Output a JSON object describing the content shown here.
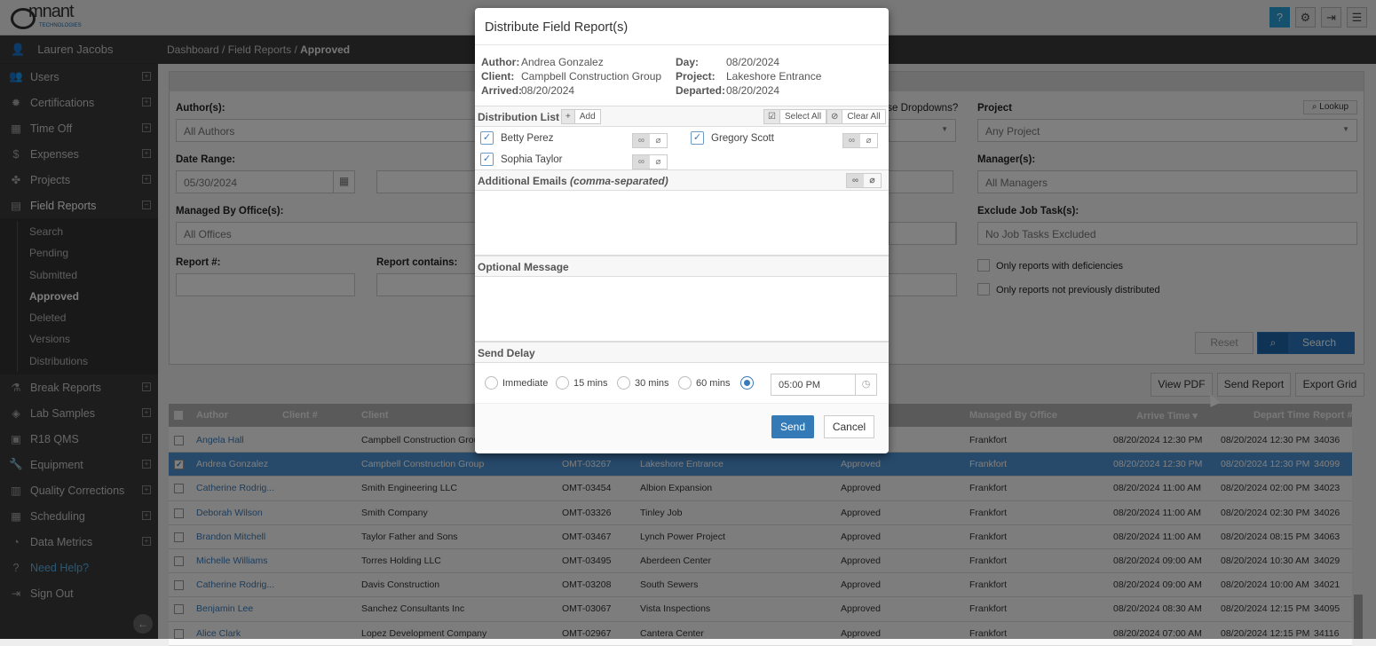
{
  "brand": {
    "name": "mnant",
    "tagline": "TECHNOLOGIES"
  },
  "topbar": {
    "icons": [
      "help-icon",
      "gear-icon",
      "logout-icon",
      "menu-icon"
    ]
  },
  "sidebar": {
    "user": "Lauren Jacobs",
    "items": [
      {
        "label": "Users",
        "icon": "users-icon",
        "glyph": "👥"
      },
      {
        "label": "Certifications",
        "icon": "certificate-icon",
        "glyph": "✹"
      },
      {
        "label": "Time Off",
        "icon": "calendar-clock-icon",
        "glyph": "▦"
      },
      {
        "label": "Expenses",
        "icon": "dollar-icon",
        "glyph": "$"
      },
      {
        "label": "Projects",
        "icon": "puzzle-icon",
        "glyph": "✤"
      },
      {
        "label": "Field Reports",
        "icon": "document-icon",
        "glyph": "▤"
      }
    ],
    "sub": [
      "Search",
      "Pending",
      "Submitted",
      "Approved",
      "Deleted",
      "Versions",
      "Distributions"
    ],
    "items2": [
      {
        "label": "Break Reports",
        "icon": "flask-icon",
        "glyph": "⚗"
      },
      {
        "label": "Lab Samples",
        "icon": "tag-icon",
        "glyph": "◈"
      },
      {
        "label": "R18 QMS",
        "icon": "certificate-doc-icon",
        "glyph": "▣"
      },
      {
        "label": "Equipment",
        "icon": "wrench-icon",
        "glyph": "🔧"
      },
      {
        "label": "Quality Corrections",
        "icon": "clipboard-icon",
        "glyph": "▥"
      },
      {
        "label": "Scheduling",
        "icon": "calendar-icon",
        "glyph": "▦"
      },
      {
        "label": "Data Metrics",
        "icon": "dashboard-icon",
        "glyph": "◔"
      }
    ],
    "help": "Need Help?",
    "signout": "Sign Out"
  },
  "breadcrumb": [
    "Dashboard",
    "Field Reports",
    "Approved"
  ],
  "filters": {
    "authors_label": "Author(s):",
    "authors_value": "All Authors",
    "date_label": "Date Range:",
    "date_from": "05/30/2024",
    "office_label": "Managed By Office(s):",
    "office_value": "All Offices",
    "report_label": "Report #:",
    "contains_label": "Report contains:",
    "dropdowns_label": "Use Dropdowns?",
    "project_label": "Project",
    "project_value": "Any Project",
    "lookup": "Lookup",
    "managers_label": "Manager(s):",
    "managers_value": "All Managers",
    "exclude_label": "Exclude Job Task(s):",
    "exclude_value": "No Job Tasks Excluded",
    "chk_deficiencies": "Only reports with deficiencies",
    "chk_not_distributed": "Only reports not previously distributed",
    "reset": "Reset",
    "search": "Search"
  },
  "actions": {
    "view_pdf": "View PDF",
    "send_report": "Send Report",
    "export_grid": "Export Grid"
  },
  "grid": {
    "headers": {
      "author": "Author",
      "client_no": "Client #",
      "client": "Client",
      "office": "Managed By Office",
      "arrive": "Arrive Time ▾",
      "depart": "Depart Time",
      "report": "Report #"
    },
    "rows": [
      {
        "author": "Angela Hall",
        "client": "Campbell Construction Group",
        "proj_no": "",
        "project": "",
        "status": "",
        "office": "Frankfort",
        "arrive": "08/20/2024 12:30 PM",
        "depart": "08/20/2024 12:30 PM",
        "report": "34036",
        "selected": false
      },
      {
        "author": "Andrea Gonzalez",
        "client": "Campbell Construction Group",
        "proj_no": "OMT-03267",
        "project": "Lakeshore Entrance",
        "status": "Approved",
        "office": "Frankfort",
        "arrive": "08/20/2024 12:30 PM",
        "depart": "08/20/2024 12:30 PM",
        "report": "34099",
        "selected": true
      },
      {
        "author": "Catherine Rodrig...",
        "client": "Smith Engineering LLC",
        "proj_no": "OMT-03454",
        "project": "Albion Expansion",
        "status": "Approved",
        "office": "Frankfort",
        "arrive": "08/20/2024 11:00 AM",
        "depart": "08/20/2024 02:00 PM",
        "report": "34023",
        "selected": false
      },
      {
        "author": "Deborah Wilson",
        "client": "Smith Company",
        "proj_no": "OMT-03326",
        "project": "Tinley Job",
        "status": "Approved",
        "office": "Frankfort",
        "arrive": "08/20/2024 11:00 AM",
        "depart": "08/20/2024 02:30 PM",
        "report": "34026",
        "selected": false
      },
      {
        "author": "Brandon Mitchell",
        "client": "Taylor Father and Sons",
        "proj_no": "OMT-03467",
        "project": "Lynch Power Project",
        "status": "Approved",
        "office": "Frankfort",
        "arrive": "08/20/2024 11:00 AM",
        "depart": "08/20/2024 08:15 PM",
        "report": "34063",
        "selected": false
      },
      {
        "author": "Michelle Williams",
        "client": "Torres Holding LLC",
        "proj_no": "OMT-03495",
        "project": "Aberdeen Center",
        "status": "Approved",
        "office": "Frankfort",
        "arrive": "08/20/2024 09:00 AM",
        "depart": "08/20/2024 10:30 AM",
        "report": "34029",
        "selected": false
      },
      {
        "author": "Catherine Rodrig...",
        "client": "Davis Construction",
        "proj_no": "OMT-03208",
        "project": "South Sewers",
        "status": "Approved",
        "office": "Frankfort",
        "arrive": "08/20/2024 09:00 AM",
        "depart": "08/20/2024 10:00 AM",
        "report": "34021",
        "selected": false
      },
      {
        "author": "Benjamin Lee",
        "client": "Sanchez Consultants Inc",
        "proj_no": "OMT-03067",
        "project": "Vista Inspections",
        "status": "Approved",
        "office": "Frankfort",
        "arrive": "08/20/2024 08:30 AM",
        "depart": "08/20/2024 12:15 PM",
        "report": "34095",
        "selected": false
      },
      {
        "author": "Alice Clark",
        "client": "Lopez Development Company",
        "proj_no": "OMT-02967",
        "project": "Cantera Center",
        "status": "Approved",
        "office": "Frankfort",
        "arrive": "08/20/2024 07:00 AM",
        "depart": "08/20/2024 12:15 PM",
        "report": "34116",
        "selected": false
      }
    ]
  },
  "modal": {
    "title": "Distribute Field Report(s)",
    "info": {
      "author_k": "Author:",
      "author": "Andrea Gonzalez",
      "client_k": "Client:",
      "client": "Campbell Construction Group",
      "arrived_k": "Arrived:",
      "arrived": "08/20/2024",
      "day_k": "Day:",
      "day": "08/20/2024",
      "project_k": "Project:",
      "project": "Lakeshore Entrance",
      "departed_k": "Departed:",
      "departed": "08/20/2024"
    },
    "dist_label": "Distribution List",
    "add": "Add",
    "select_all": "Select All",
    "clear_all": "Clear All",
    "recipients": [
      {
        "name": "Betty Perez",
        "checked": true
      },
      {
        "name": "Gregory Scott",
        "checked": true
      },
      {
        "name": "Sophia Taylor",
        "checked": true
      }
    ],
    "emails_label": "Additional Emails",
    "emails_hint": "(comma-separated)",
    "emails_value": "",
    "message_label": "Optional Message",
    "message_value": "",
    "delay_label": "Send Delay",
    "delay_options": [
      "Immediate",
      "15 mins",
      "30 mins",
      "60 mins"
    ],
    "delay_selected": "custom",
    "time": "05:00 PM",
    "send": "Send",
    "cancel": "Cancel"
  }
}
